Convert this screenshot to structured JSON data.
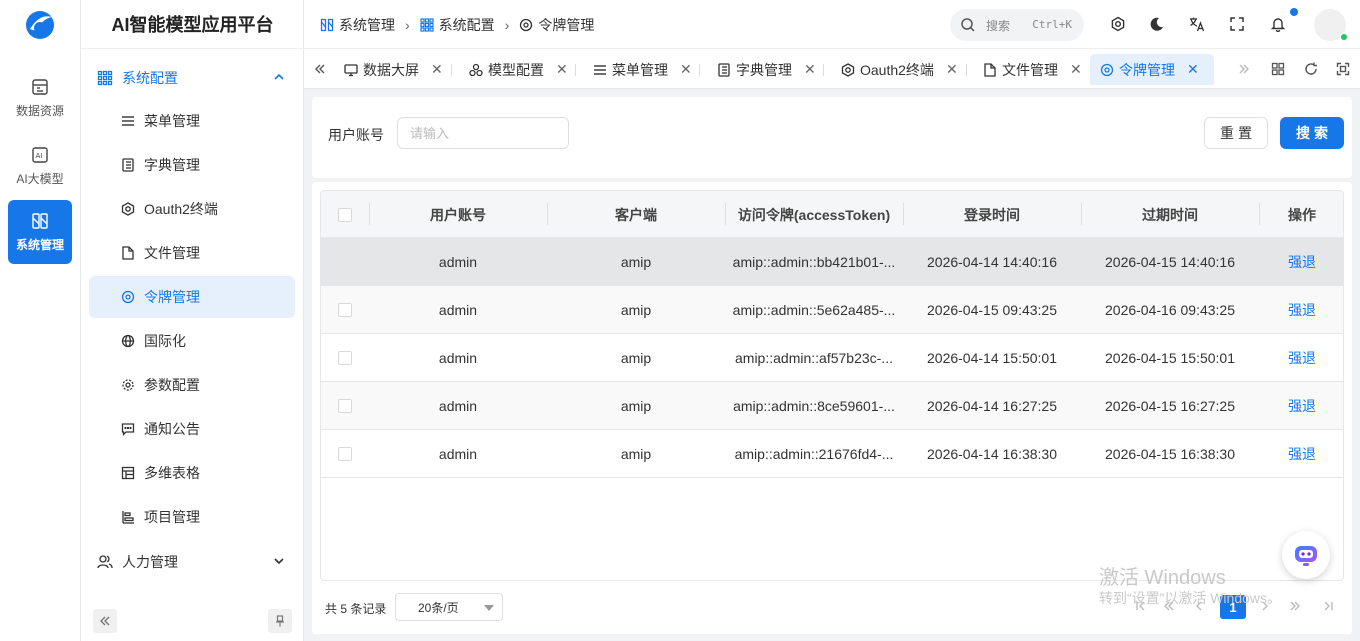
{
  "app": {
    "title": "AI智能模型应用平台"
  },
  "rail": {
    "items": [
      {
        "label": "数据资源",
        "icon": "data-resource-icon"
      },
      {
        "label": "AI大模型",
        "icon": "ai-model-icon"
      },
      {
        "label": "系统管理",
        "icon": "system-manage-icon",
        "active": true
      }
    ]
  },
  "sidebar": {
    "group1": "系统配置",
    "items": [
      {
        "label": "菜单管理",
        "icon": "menu-list-icon"
      },
      {
        "label": "字典管理",
        "icon": "dictionary-icon"
      },
      {
        "label": "Oauth2终端",
        "icon": "oauth-icon"
      },
      {
        "label": "文件管理",
        "icon": "file-icon"
      },
      {
        "label": "令牌管理",
        "icon": "token-icon",
        "active": true
      },
      {
        "label": "国际化",
        "icon": "globe-icon"
      },
      {
        "label": "参数配置",
        "icon": "param-gear-icon"
      },
      {
        "label": "通知公告",
        "icon": "message-icon"
      },
      {
        "label": "多维表格",
        "icon": "table-icon"
      },
      {
        "label": "项目管理",
        "icon": "project-icon"
      }
    ],
    "group2": "人力管理"
  },
  "breadcrumb": [
    "系统管理",
    "系统配置",
    "令牌管理"
  ],
  "header": {
    "search_placeholder": "搜索",
    "search_shortcut": "Ctrl+K"
  },
  "tabs": [
    {
      "label": "数据大屏",
      "icon": "monitor-icon"
    },
    {
      "label": "模型配置",
      "icon": "model-config-icon"
    },
    {
      "label": "菜单管理",
      "icon": "menu-list-icon"
    },
    {
      "label": "字典管理",
      "icon": "dictionary-icon"
    },
    {
      "label": "Oauth2终端",
      "icon": "oauth-icon"
    },
    {
      "label": "文件管理",
      "icon": "file-icon"
    },
    {
      "label": "令牌管理",
      "icon": "token-icon",
      "active": true
    }
  ],
  "filter": {
    "label": "用户账号",
    "placeholder": "请输入",
    "reset": "重置",
    "search": "搜索"
  },
  "table": {
    "columns": [
      "用户账号",
      "客户端",
      "访问令牌(accessToken)",
      "登录时间",
      "过期时间",
      "操作"
    ],
    "rows": [
      {
        "user": "admin",
        "client": "amip",
        "token": "amip::admin::bb421b01-...",
        "login": "2026-04-14 14:40:16",
        "expire": "2026-04-15 14:40:16",
        "op": "强退"
      },
      {
        "user": "admin",
        "client": "amip",
        "token": "amip::admin::5e62a485-...",
        "login": "2026-04-15 09:43:25",
        "expire": "2026-04-16 09:43:25",
        "op": "强退"
      },
      {
        "user": "admin",
        "client": "amip",
        "token": "amip::admin::af57b23c-...",
        "login": "2026-04-14 15:50:01",
        "expire": "2026-04-15 15:50:01",
        "op": "强退"
      },
      {
        "user": "admin",
        "client": "amip",
        "token": "amip::admin::8ce59601-...",
        "login": "2026-04-14 16:27:25",
        "expire": "2026-04-15 16:27:25",
        "op": "强退"
      },
      {
        "user": "admin",
        "client": "amip",
        "token": "amip::admin::21676fd4-...",
        "login": "2026-04-14 16:38:30",
        "expire": "2026-04-15 16:38:30",
        "op": "强退"
      }
    ]
  },
  "pagination": {
    "total": "共 5 条记录",
    "page_size": "20条/页",
    "current": "1"
  },
  "watermark": {
    "line1": "激活 Windows",
    "line2": "转到“设置”以激活 Windows。"
  },
  "colors": {
    "accent": "#1677e8"
  }
}
